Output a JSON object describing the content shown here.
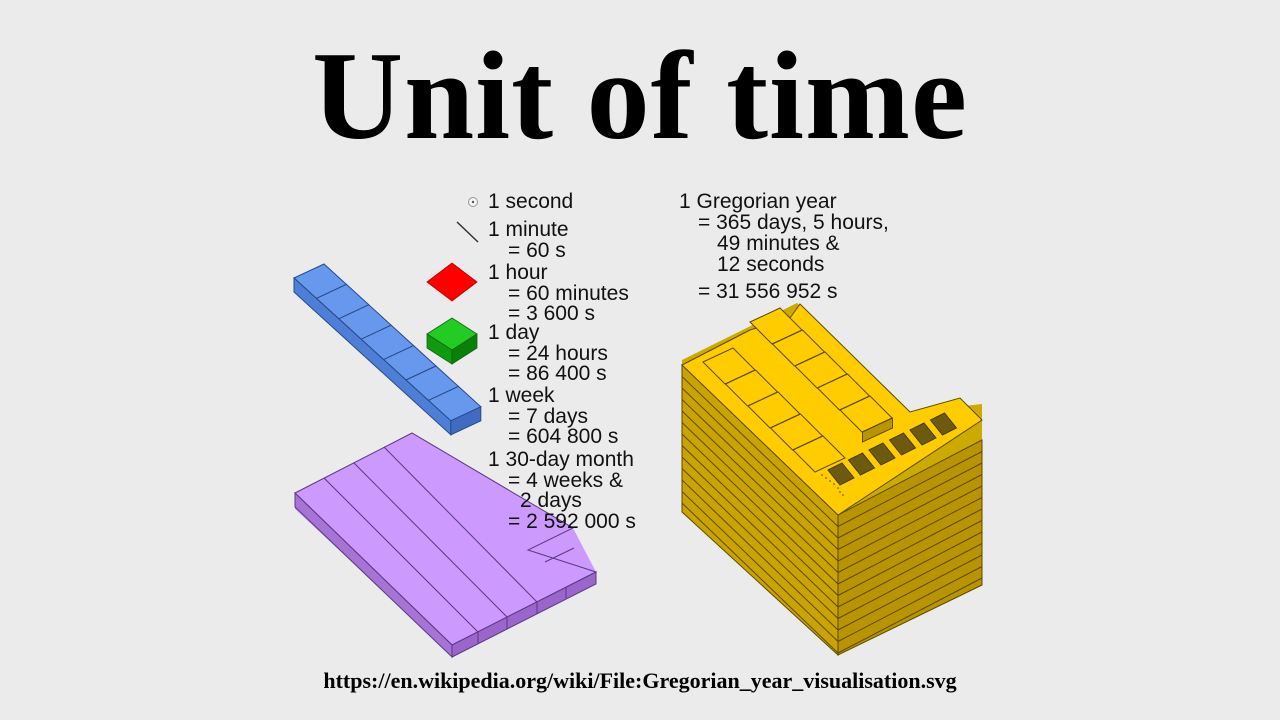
{
  "title": "Unit of time",
  "source_url": "https://en.wikipedia.org/wiki/File:Gregorian_year_visualisation.svg",
  "units": [
    {
      "id": "second",
      "icon": "dot-circle-icon",
      "lines": [
        "1 second"
      ]
    },
    {
      "id": "minute",
      "icon": "line-segment-icon",
      "lines": [
        "1 minute",
        "= 60 s"
      ]
    },
    {
      "id": "hour",
      "icon": "red-square-icon",
      "color": "#ff0000",
      "lines": [
        "1 hour",
        "= 60 minutes",
        "= 3 600 s"
      ]
    },
    {
      "id": "day",
      "icon": "green-cube-icon",
      "color": "#00bb00",
      "lines": [
        "1 day",
        "= 24 hours",
        "= 86 400 s"
      ]
    },
    {
      "id": "week",
      "icon": "blue-bar-icon",
      "color": "#6699ee",
      "lines": [
        "1 week",
        "= 7 days",
        "= 604 800 s"
      ]
    },
    {
      "id": "month",
      "icon": "purple-slab-icon",
      "color": "#cc99ff",
      "lines": [
        "1 30-day month",
        "= 4 weeks &",
        "2 days",
        "= 2 592 000 s"
      ]
    }
  ],
  "year": {
    "icon": "yellow-block-icon",
    "color": "#ffcc00",
    "lines": [
      "1 Gregorian year",
      "= 365 days, 5 hours,",
      "49 minutes &",
      "12 seconds",
      "= 31 556 952 s"
    ]
  }
}
